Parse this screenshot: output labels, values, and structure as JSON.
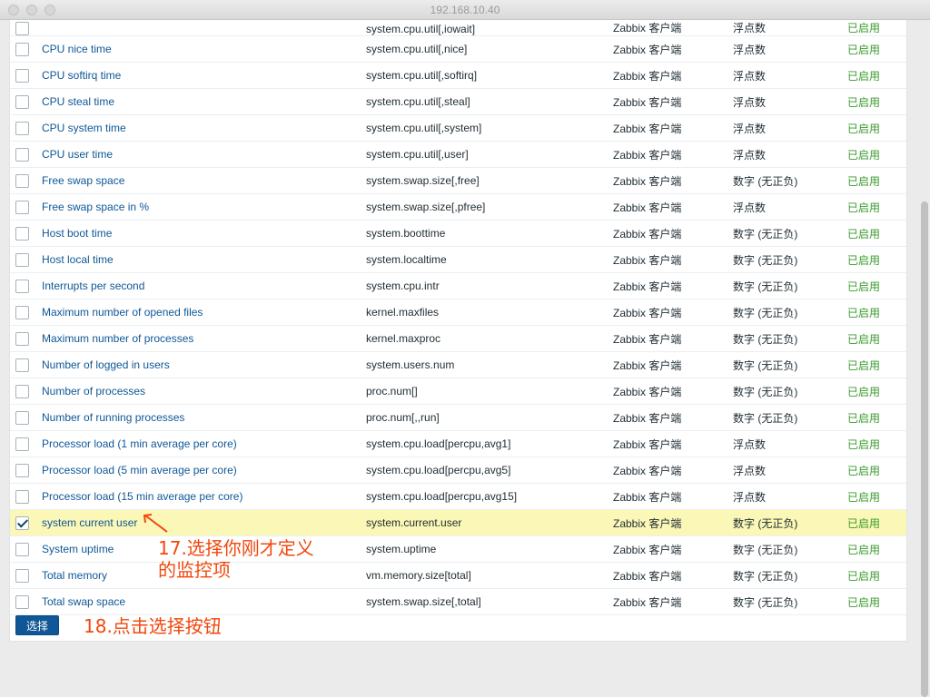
{
  "window": {
    "title": "192.168.10.40"
  },
  "partial_row": {
    "name": "",
    "key": "system.cpu.util[,iowait]",
    "type": "Zabbix 客户端",
    "value_type": "浮点数",
    "status": "已启用"
  },
  "rows": [
    {
      "name": "CPU nice time",
      "key": "system.cpu.util[,nice]",
      "type": "Zabbix 客户端",
      "value_type": "浮点数",
      "status": "已启用",
      "checked": false
    },
    {
      "name": "CPU softirq time",
      "key": "system.cpu.util[,softirq]",
      "type": "Zabbix 客户端",
      "value_type": "浮点数",
      "status": "已启用",
      "checked": false
    },
    {
      "name": "CPU steal time",
      "key": "system.cpu.util[,steal]",
      "type": "Zabbix 客户端",
      "value_type": "浮点数",
      "status": "已启用",
      "checked": false
    },
    {
      "name": "CPU system time",
      "key": "system.cpu.util[,system]",
      "type": "Zabbix 客户端",
      "value_type": "浮点数",
      "status": "已启用",
      "checked": false
    },
    {
      "name": "CPU user time",
      "key": "system.cpu.util[,user]",
      "type": "Zabbix 客户端",
      "value_type": "浮点数",
      "status": "已启用",
      "checked": false
    },
    {
      "name": "Free swap space",
      "key": "system.swap.size[,free]",
      "type": "Zabbix 客户端",
      "value_type": "数字 (无正负)",
      "status": "已启用",
      "checked": false
    },
    {
      "name": "Free swap space in %",
      "key": "system.swap.size[,pfree]",
      "type": "Zabbix 客户端",
      "value_type": "浮点数",
      "status": "已启用",
      "checked": false
    },
    {
      "name": "Host boot time",
      "key": "system.boottime",
      "type": "Zabbix 客户端",
      "value_type": "数字 (无正负)",
      "status": "已启用",
      "checked": false
    },
    {
      "name": "Host local time",
      "key": "system.localtime",
      "type": "Zabbix 客户端",
      "value_type": "数字 (无正负)",
      "status": "已启用",
      "checked": false
    },
    {
      "name": "Interrupts per second",
      "key": "system.cpu.intr",
      "type": "Zabbix 客户端",
      "value_type": "数字 (无正负)",
      "status": "已启用",
      "checked": false
    },
    {
      "name": "Maximum number of opened files",
      "key": "kernel.maxfiles",
      "type": "Zabbix 客户端",
      "value_type": "数字 (无正负)",
      "status": "已启用",
      "checked": false
    },
    {
      "name": "Maximum number of processes",
      "key": "kernel.maxproc",
      "type": "Zabbix 客户端",
      "value_type": "数字 (无正负)",
      "status": "已启用",
      "checked": false
    },
    {
      "name": "Number of logged in users",
      "key": "system.users.num",
      "type": "Zabbix 客户端",
      "value_type": "数字 (无正负)",
      "status": "已启用",
      "checked": false
    },
    {
      "name": "Number of processes",
      "key": "proc.num[]",
      "type": "Zabbix 客户端",
      "value_type": "数字 (无正负)",
      "status": "已启用",
      "checked": false
    },
    {
      "name": "Number of running processes",
      "key": "proc.num[,,run]",
      "type": "Zabbix 客户端",
      "value_type": "数字 (无正负)",
      "status": "已启用",
      "checked": false
    },
    {
      "name": "Processor load (1 min average per core)",
      "key": "system.cpu.load[percpu,avg1]",
      "type": "Zabbix 客户端",
      "value_type": "浮点数",
      "status": "已启用",
      "checked": false
    },
    {
      "name": "Processor load (5 min average per core)",
      "key": "system.cpu.load[percpu,avg5]",
      "type": "Zabbix 客户端",
      "value_type": "浮点数",
      "status": "已启用",
      "checked": false
    },
    {
      "name": "Processor load (15 min average per core)",
      "key": "system.cpu.load[percpu,avg15]",
      "type": "Zabbix 客户端",
      "value_type": "浮点数",
      "status": "已启用",
      "checked": false
    },
    {
      "name": "system current user",
      "key": "system.current.user",
      "type": "Zabbix 客户端",
      "value_type": "数字 (无正负)",
      "status": "已启用",
      "checked": true
    },
    {
      "name": "System uptime",
      "key": "system.uptime",
      "type": "Zabbix 客户端",
      "value_type": "数字 (无正负)",
      "status": "已启用",
      "checked": false
    },
    {
      "name": "Total memory",
      "key": "vm.memory.size[total]",
      "type": "Zabbix 客户端",
      "value_type": "数字 (无正负)",
      "status": "已启用",
      "checked": false
    },
    {
      "name": "Total swap space",
      "key": "system.swap.size[,total]",
      "type": "Zabbix 客户端",
      "value_type": "数字 (无正负)",
      "status": "已启用",
      "checked": false
    }
  ],
  "footer": {
    "select_label": "选择"
  },
  "annotations": {
    "step17_line1": "17.选择你刚才定义",
    "step17_line2": "的监控项",
    "step18": "18.点击选择按钮"
  },
  "colors": {
    "link": "#0f5796",
    "status_enabled": "#3a9a2d",
    "selected_row": "#fbf7b6",
    "button": "#0f5796",
    "annotation": "#f2470c"
  }
}
